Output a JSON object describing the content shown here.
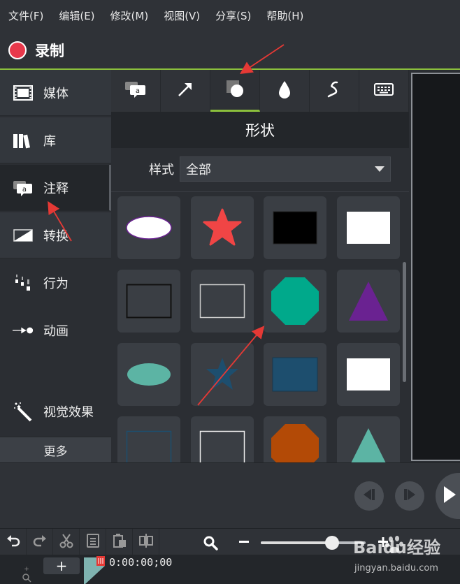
{
  "menu": {
    "items": [
      "文件(F)",
      "编辑(E)",
      "修改(M)",
      "视图(V)",
      "分享(S)",
      "帮助(H)"
    ]
  },
  "record": {
    "label": "录制"
  },
  "nav": {
    "items": [
      {
        "label": "媒体"
      },
      {
        "label": "库"
      },
      {
        "label": "注释"
      },
      {
        "label": "转换"
      },
      {
        "label": "行为"
      },
      {
        "label": "动画"
      },
      {
        "label": "视觉效果"
      }
    ],
    "more": "更多"
  },
  "panel": {
    "title": "形状",
    "style_label": "样式",
    "style_value": "全部"
  },
  "timeline": {
    "add": "+",
    "time": "0:00:00;00"
  },
  "watermark": {
    "brand": "Baidu经验",
    "url": "jingyan.baidu.com"
  },
  "zoom": {
    "level": 0.68
  },
  "colors": {
    "accent_green": "#8bbf3c",
    "record_red": "#e8384b",
    "arrow_red": "#e53935",
    "teal": "#00a98b",
    "purple": "#6a2291",
    "orange": "#b34a06",
    "navy": "#1d4e6e",
    "shape_red": "#f04545",
    "mint": "#5cb4a4"
  }
}
